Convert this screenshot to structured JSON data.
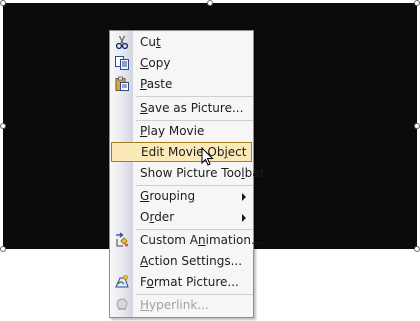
{
  "menu": {
    "items": [
      {
        "id": "cut",
        "label": "Cut",
        "underline_index": 2,
        "icon": "scissors-icon",
        "y": 0
      },
      {
        "id": "copy",
        "label": "Copy",
        "underline_index": 0,
        "icon": "copy-icon",
        "y": 0
      },
      {
        "id": "paste",
        "label": "Paste",
        "underline_index": 0,
        "icon": "paste-icon",
        "y": 0
      },
      {
        "id": "save-as-picture",
        "label": "Save as Picture...",
        "underline_index": 0,
        "icon": "",
        "y": 0
      },
      {
        "id": "play-movie",
        "label": "Play Movie",
        "underline_index": 0,
        "icon": "",
        "y": 0
      },
      {
        "id": "edit-movie-object",
        "label": "Edit Movie Object",
        "underline_index": 13,
        "icon": "",
        "state": "highlighted",
        "y": 0
      },
      {
        "id": "show-picture-toolbar",
        "label": "Show Picture Toolbar",
        "underline_index": 16,
        "icon": "",
        "y": 0
      },
      {
        "id": "grouping",
        "label": "Grouping",
        "underline_index": 0,
        "icon": "",
        "submenu": true,
        "y": 0
      },
      {
        "id": "order",
        "label": "Order",
        "underline_index": 1,
        "icon": "",
        "submenu": true,
        "y": 0
      },
      {
        "id": "custom-animation",
        "label": "Custom Animation...",
        "underline_index": 8,
        "icon": "custom-animation-icon",
        "y": 0
      },
      {
        "id": "action-settings",
        "label": "Action Settings...",
        "underline_index": 0,
        "icon": "",
        "y": 0
      },
      {
        "id": "format-picture",
        "label": "Format Picture...",
        "underline_index": 1,
        "icon": "format-picture-icon",
        "y": 0
      },
      {
        "id": "hyperlink",
        "label": "Hyperlink...",
        "underline_index": 0,
        "icon": "hyperlink-icon",
        "state": "disabled",
        "y": 0
      }
    ]
  },
  "colors": {
    "highlight_background": "#fbe9b8",
    "highlight_border": "#a57e24",
    "disabled_text": "#a2a2a2",
    "object_fill": "#0b0b0b"
  }
}
